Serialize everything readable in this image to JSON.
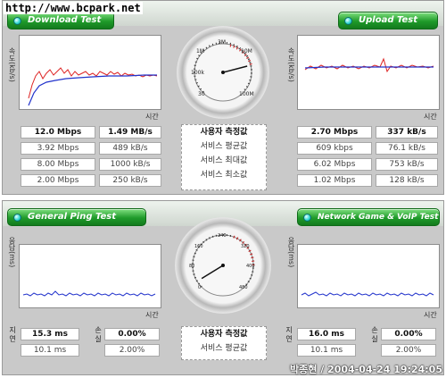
{
  "watermark": {
    "url": "http://www.bcpark.net",
    "signature": "박종현 / 2004-04-24 19:24:05"
  },
  "top": {
    "download_btn": "Download Test",
    "upload_btn": "Upload Test",
    "ylabel": "속도(kb/s)",
    "xlabel": "시간",
    "labels": [
      "사용자 측정값",
      "서비스 평균값",
      "서비스 최대값",
      "서비스 최소값"
    ],
    "download_rows": [
      [
        "12.0 Mbps",
        "1.49 MB/s"
      ],
      [
        "3.92 Mbps",
        "489 kB/s"
      ],
      [
        "8.00 Mbps",
        "1000 kB/s"
      ],
      [
        "2.00 Mbps",
        "250 kB/s"
      ]
    ],
    "upload_rows": [
      [
        "2.70 Mbps",
        "337 kB/s"
      ],
      [
        "609 kbps",
        "76.1 kB/s"
      ],
      [
        "6.02 Mbps",
        "753 kB/s"
      ],
      [
        "1.02 Mbps",
        "128 kB/s"
      ]
    ],
    "gauge_ticks": [
      "30",
      "100k",
      "1M",
      "3M",
      "10M",
      "100M"
    ],
    "gauge_value_fraction": 0.78
  },
  "bottom": {
    "ping_btn": "General Ping Test",
    "game_btn": "Network Game & VoIP Test",
    "ylabel": "응답(ms)",
    "xlabel": "시간",
    "side_latency": "지연",
    "side_loss": "손실",
    "labels": [
      "사용자 측정값",
      "서비스 평균값"
    ],
    "ping_rows": [
      [
        "15.3 ms",
        "0.00%"
      ],
      [
        "10.1 ms",
        "2.00%"
      ]
    ],
    "game_rows": [
      [
        "16.0 ms",
        "0.00%"
      ],
      [
        "10.1 ms",
        "2.00%"
      ]
    ],
    "gauge_ticks": [
      "0",
      "40",
      "80",
      "120",
      "160",
      "200",
      "240",
      "280",
      "320",
      "360",
      "400",
      "440",
      "480"
    ],
    "gauge_value_fraction": 0.05
  },
  "colors": {
    "accent_green": "#1f9a2a",
    "line_red": "#dd2222",
    "line_blue": "#2233cc"
  }
}
